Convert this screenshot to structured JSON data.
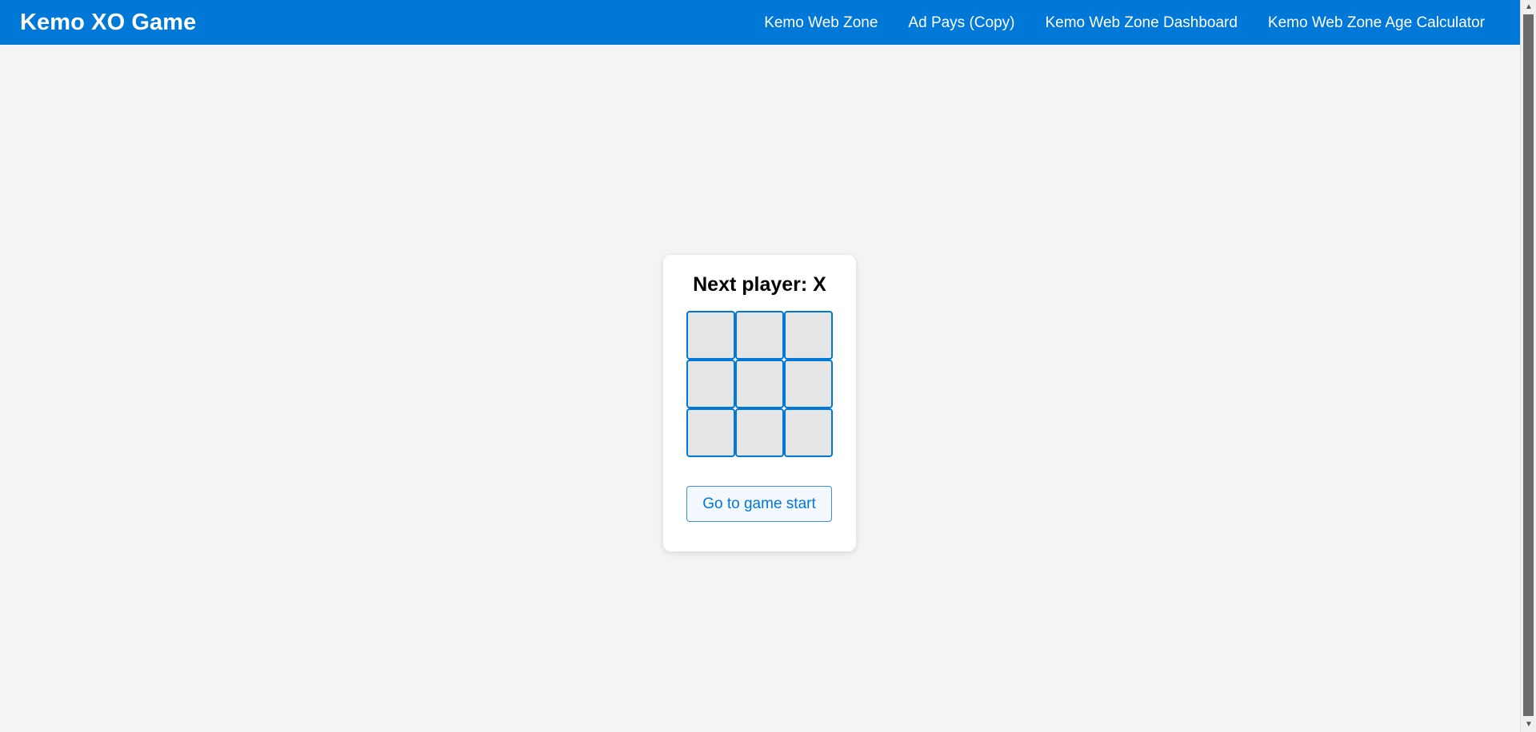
{
  "header": {
    "title": "Kemo XO Game",
    "nav": [
      {
        "label": "Kemo Web Zone"
      },
      {
        "label": "Ad Pays (Copy)"
      },
      {
        "label": "Kemo Web Zone Dashboard"
      },
      {
        "label": "Kemo Web Zone Age Calculator"
      }
    ]
  },
  "game": {
    "status": "Next player: X",
    "board": [
      "",
      "",
      "",
      "",
      "",
      "",
      "",
      "",
      ""
    ],
    "restart_label": "Go to game start"
  },
  "theme": {
    "accent": "#0078d7",
    "background": "#f4f4f4",
    "card_background": "#ffffff",
    "cell_background": "#e5e5e5"
  },
  "scrollbar": {
    "up_icon": "triangle-up-icon",
    "down_icon": "triangle-down-icon"
  }
}
